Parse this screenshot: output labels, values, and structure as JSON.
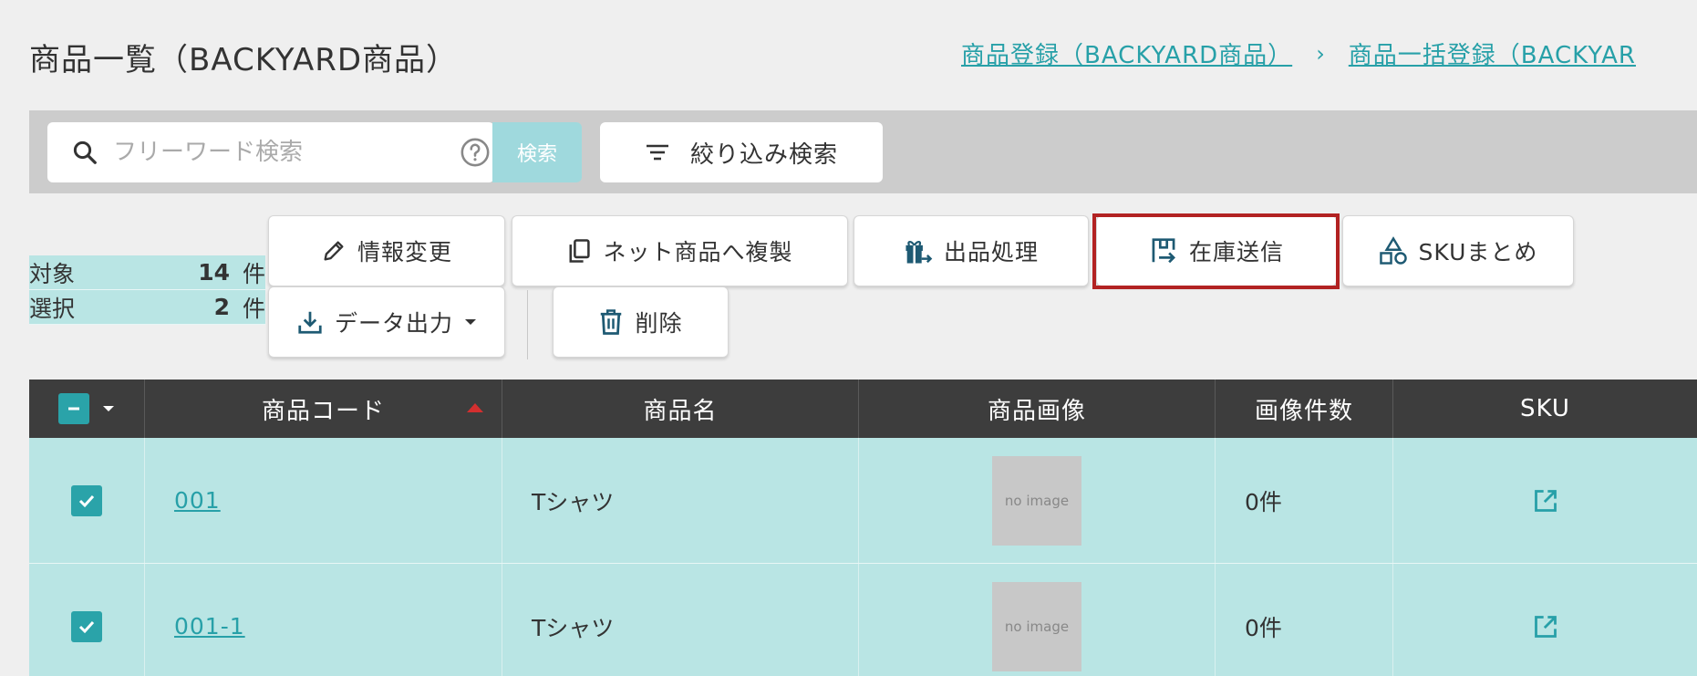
{
  "header": {
    "title": "商品一覧（BACKYARD商品）",
    "breadcrumb": [
      "商品登録（BACKYARD商品）",
      "商品一括登録（BACKYAR"
    ],
    "breadcrumb_sep": "›"
  },
  "search": {
    "placeholder": "フリーワード検索",
    "search_button": "検索",
    "filter_button": "絞り込み検索"
  },
  "counts": {
    "target_label": "対象",
    "target_value": "14",
    "target_unit": "件",
    "selected_label": "選択",
    "selected_value": "2",
    "selected_unit": "件"
  },
  "actions": {
    "edit_info": "情報変更",
    "copy_to_net": "ネット商品へ複製",
    "listing": "出品処理",
    "send_stock": "在庫送信",
    "sku_merge": "SKUまとめ",
    "export": "データ出力",
    "delete": "削除"
  },
  "table": {
    "headers": [
      "商品コード",
      "商品名",
      "商品画像",
      "画像件数",
      "SKU"
    ],
    "rows": [
      {
        "checked": true,
        "code": "001",
        "name": "Tシャツ",
        "image": "no image",
        "image_count": "0件"
      },
      {
        "checked": true,
        "code": "001-1",
        "name": "Tシャツ",
        "image": "no image",
        "image_count": "0件"
      }
    ]
  },
  "colors": {
    "accent": "#2aa3a9",
    "row_selected": "#b9e5e4",
    "header_bg": "#3d3d3d",
    "highlight": "#b22222"
  }
}
